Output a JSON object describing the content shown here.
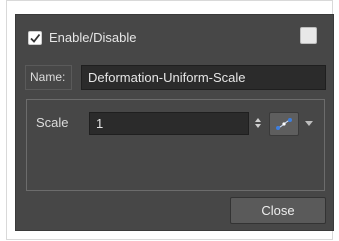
{
  "enable": {
    "label": "Enable/Disable",
    "checked": true
  },
  "color_swatch": {
    "color": "#e8e8e8"
  },
  "name": {
    "label": "Name:",
    "value": "Deformation-Uniform-Scale"
  },
  "scale": {
    "label": "Scale",
    "value": "1"
  },
  "function_button": {
    "icon": "bezier-curve-icon"
  },
  "close_label": "Close",
  "colors": {
    "panel": "#474747",
    "field": "#2b2b2b",
    "accent": "#3d7fe0"
  }
}
